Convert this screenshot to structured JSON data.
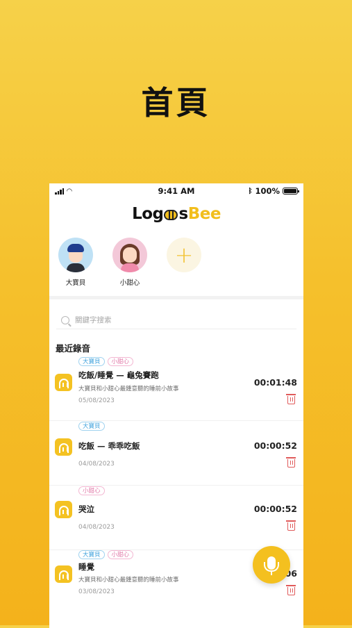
{
  "hero": {
    "title": "首頁"
  },
  "status_bar": {
    "time": "9:41 AM",
    "battery": "100%"
  },
  "app": {
    "logo_prefix": "Log",
    "logo_mid": "s",
    "logo_accent": "Bee"
  },
  "profiles": [
    {
      "name": "大寶貝"
    },
    {
      "name": "小甜心"
    }
  ],
  "search": {
    "placeholder": "關鍵字搜索"
  },
  "section": {
    "recent_title": "最近錄音"
  },
  "recordings": [
    {
      "tags": [
        "大寶貝",
        "小甜心"
      ],
      "title": "吃飯/睡覺 — 龜兔賽跑",
      "desc": "大寶貝和小甜心最鍾意聽的睡前小故事",
      "date": "05/08/2023",
      "duration": "00:01:48"
    },
    {
      "tags": [
        "大寶貝"
      ],
      "title": "吃飯 — 乖乖吃飯",
      "desc": "",
      "date": "04/08/2023",
      "duration": "00:00:52"
    },
    {
      "tags": [
        "小甜心"
      ],
      "title": "哭泣",
      "desc": "",
      "date": "04/08/2023",
      "duration": "00:00:52"
    },
    {
      "tags": [
        "大寶貝",
        "小甜心"
      ],
      "title": "睡覺",
      "desc": "大寶貝和小甜心最鍾意聽的睡前小故事",
      "date": "03/08/2023",
      "duration": "06"
    }
  ]
}
